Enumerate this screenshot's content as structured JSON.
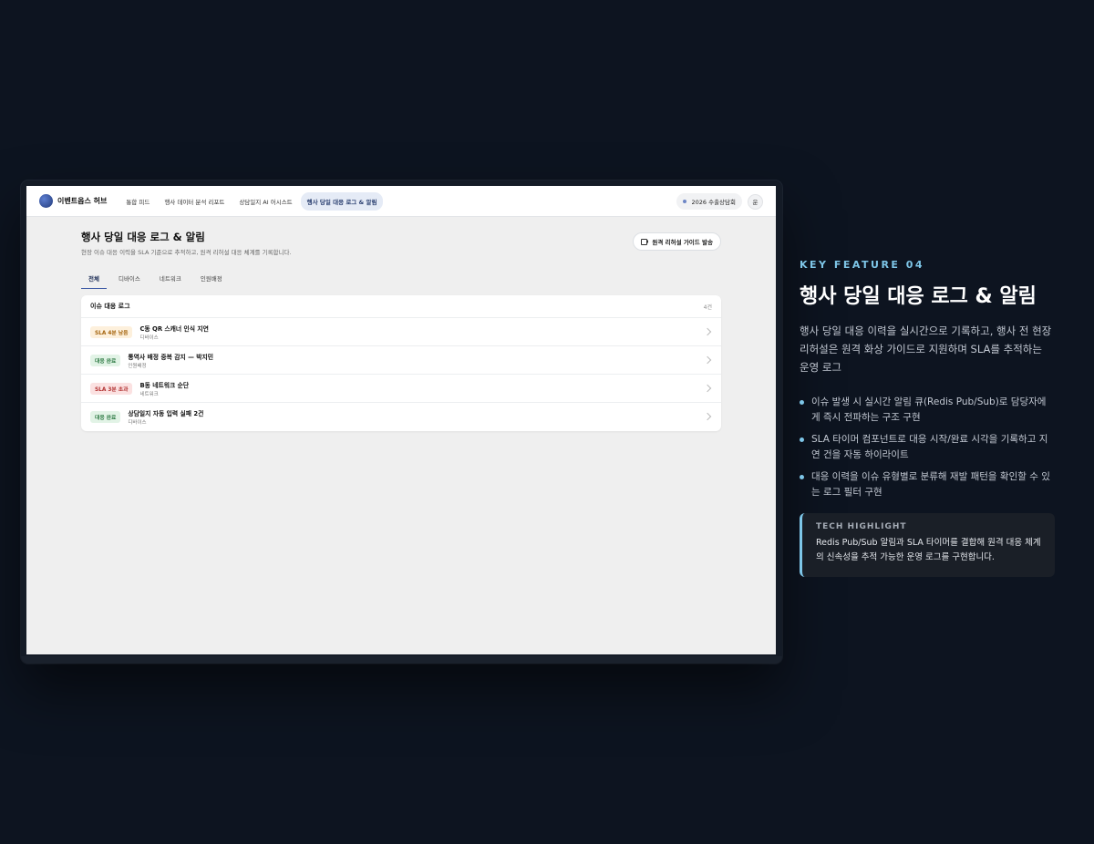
{
  "app": {
    "logo_text": "이벤트옵스 허브",
    "nav": [
      {
        "label": "통합 피드"
      },
      {
        "label": "행사 데이터 분석 리포트"
      },
      {
        "label": "상담일지 AI 어시스트"
      },
      {
        "label": "행사 당일 대응 로그 & 알림"
      }
    ],
    "event_pill": "2026 수출상담회",
    "avatar_initial": "운"
  },
  "page": {
    "title": "행사 당일 대응 로그 & 알림",
    "subtitle": "현장 이슈 대응 이력을 SLA 기준으로 추적하고, 원격 리허설 대응 체계를 기록합니다.",
    "guide_button": "원격 리허설 가이드 발송",
    "tabs": [
      {
        "label": "전체"
      },
      {
        "label": "디바이스"
      },
      {
        "label": "네트워크"
      },
      {
        "label": "인원배정"
      }
    ]
  },
  "log_card": {
    "title": "이슈 대응 로그",
    "count": "4건",
    "rows": [
      {
        "badge": "SLA 4분 남음",
        "title": "C동 QR 스캐너 인식 지연",
        "category": "디바이스"
      },
      {
        "badge": "대응 완료",
        "title": "통역사 배정 중복 감지 — 박지민",
        "category": "인원배정"
      },
      {
        "badge": "SLA 3분 초과",
        "title": "B동 네트워크 순단",
        "category": "네트워크"
      },
      {
        "badge": "대응 완료",
        "title": "상담일지 자동 입력 실패 2건",
        "category": "디바이스"
      }
    ]
  },
  "badge_colors": {
    "warn": {
      "bg": "#fdf0dc",
      "fg": "#a5650f"
    },
    "done": {
      "bg": "#e2f3e6",
      "fg": "#2e7a44"
    },
    "over": {
      "bg": "#fbe1e1",
      "fg": "#b23232"
    }
  },
  "feature": {
    "kicker": "KEY FEATURE 04",
    "title": "행사 당일 대응 로그 & 알림",
    "description": "행사 당일 대응 이력을 실시간으로 기록하고, 행사 전 현장 리허설은 원격 화상 가이드로 지원하며 SLA를 추적하는 운영 로그",
    "bullets": [
      "이슈 발생 시 실시간 알림 큐(Redis Pub/Sub)로 담당자에게 즉시 전파하는 구조 구현",
      "SLA 타이머 컴포넌트로 대응 시작/완료 시각을 기록하고 지연 건을 자동 하이라이트",
      "대응 이력을 이슈 유형별로 분류해 재발 패턴을 확인할 수 있는 로그 필터 구현"
    ],
    "highlight_label": "TECH HIGHLIGHT",
    "highlight_text": "Redis Pub/Sub 알림과 SLA 타이머를 결합해 원격 대응 체계의 신속성을 추적 가능한 운영 로그를 구현합니다."
  }
}
